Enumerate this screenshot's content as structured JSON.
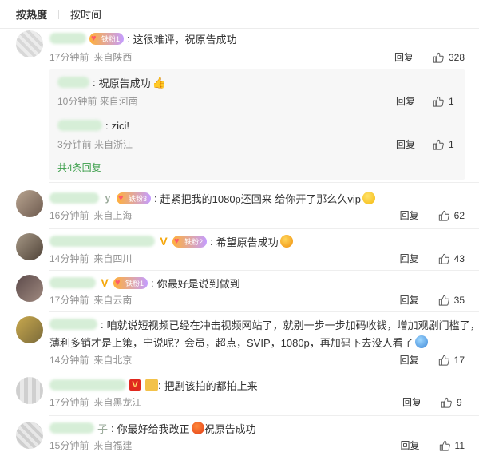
{
  "sort": {
    "hot": "按热度",
    "time": "按时间"
  },
  "labels": {
    "reply": "回复",
    "from_prefix": "来自"
  },
  "colors": {
    "link_green": "#3b9e4a",
    "meta_gray": "#939393",
    "fan_badge_start": "#ffb03a",
    "vip_gold": "#f5a70c"
  },
  "comments": [
    {
      "badge": "铁粉1",
      "text": "这很难评，祝原告成功",
      "time": "17分钟前",
      "location": "来自陕西",
      "likes": "328",
      "replies": [
        {
          "text": "祝原告成功",
          "time": "10分钟前",
          "location": "来自河南",
          "likes": "1",
          "emoji": "thumbs-up"
        },
        {
          "text": "zici!",
          "time": "3分钟前",
          "location": "来自浙江",
          "likes": "1"
        }
      ],
      "more_replies": "共4条回复"
    },
    {
      "badge": "铁粉3",
      "text": "赶紧把我的1080p还回来 给你开了那么久vip",
      "time": "16分钟前",
      "location": "来自上海",
      "likes": "62",
      "emoji": "smile"
    },
    {
      "badge": "铁粉2",
      "text": "希望原告成功",
      "time": "14分钟前",
      "location": "来自四川",
      "likes": "43",
      "emoji": "heart-eyes"
    },
    {
      "badge": "铁粉1",
      "text": "你最好是说到做到",
      "time": "17分钟前",
      "location": "来自云南",
      "likes": "35"
    },
    {
      "text_line1": "咱就说短视频已经在冲击视频网站了，就别一步一步加码收钱，增加观剧门槛了，",
      "text_line2": "薄利多销才是上策，宁说呢？会员，超点，SVIP，1080p，再加码下去没人看了",
      "time": "14分钟前",
      "location": "来自北京",
      "likes": "17",
      "emoji": "dog"
    },
    {
      "text": "把剧该拍的都拍上来",
      "time": "17分钟前",
      "location": "来自黑龙江",
      "likes": "9"
    },
    {
      "name_suffix": "子",
      "text_before": "你最好给我改正",
      "text_after": "祝原告成功",
      "time": "15分钟前",
      "location": "来自福建",
      "likes": "11",
      "emoji": "angry"
    }
  ]
}
